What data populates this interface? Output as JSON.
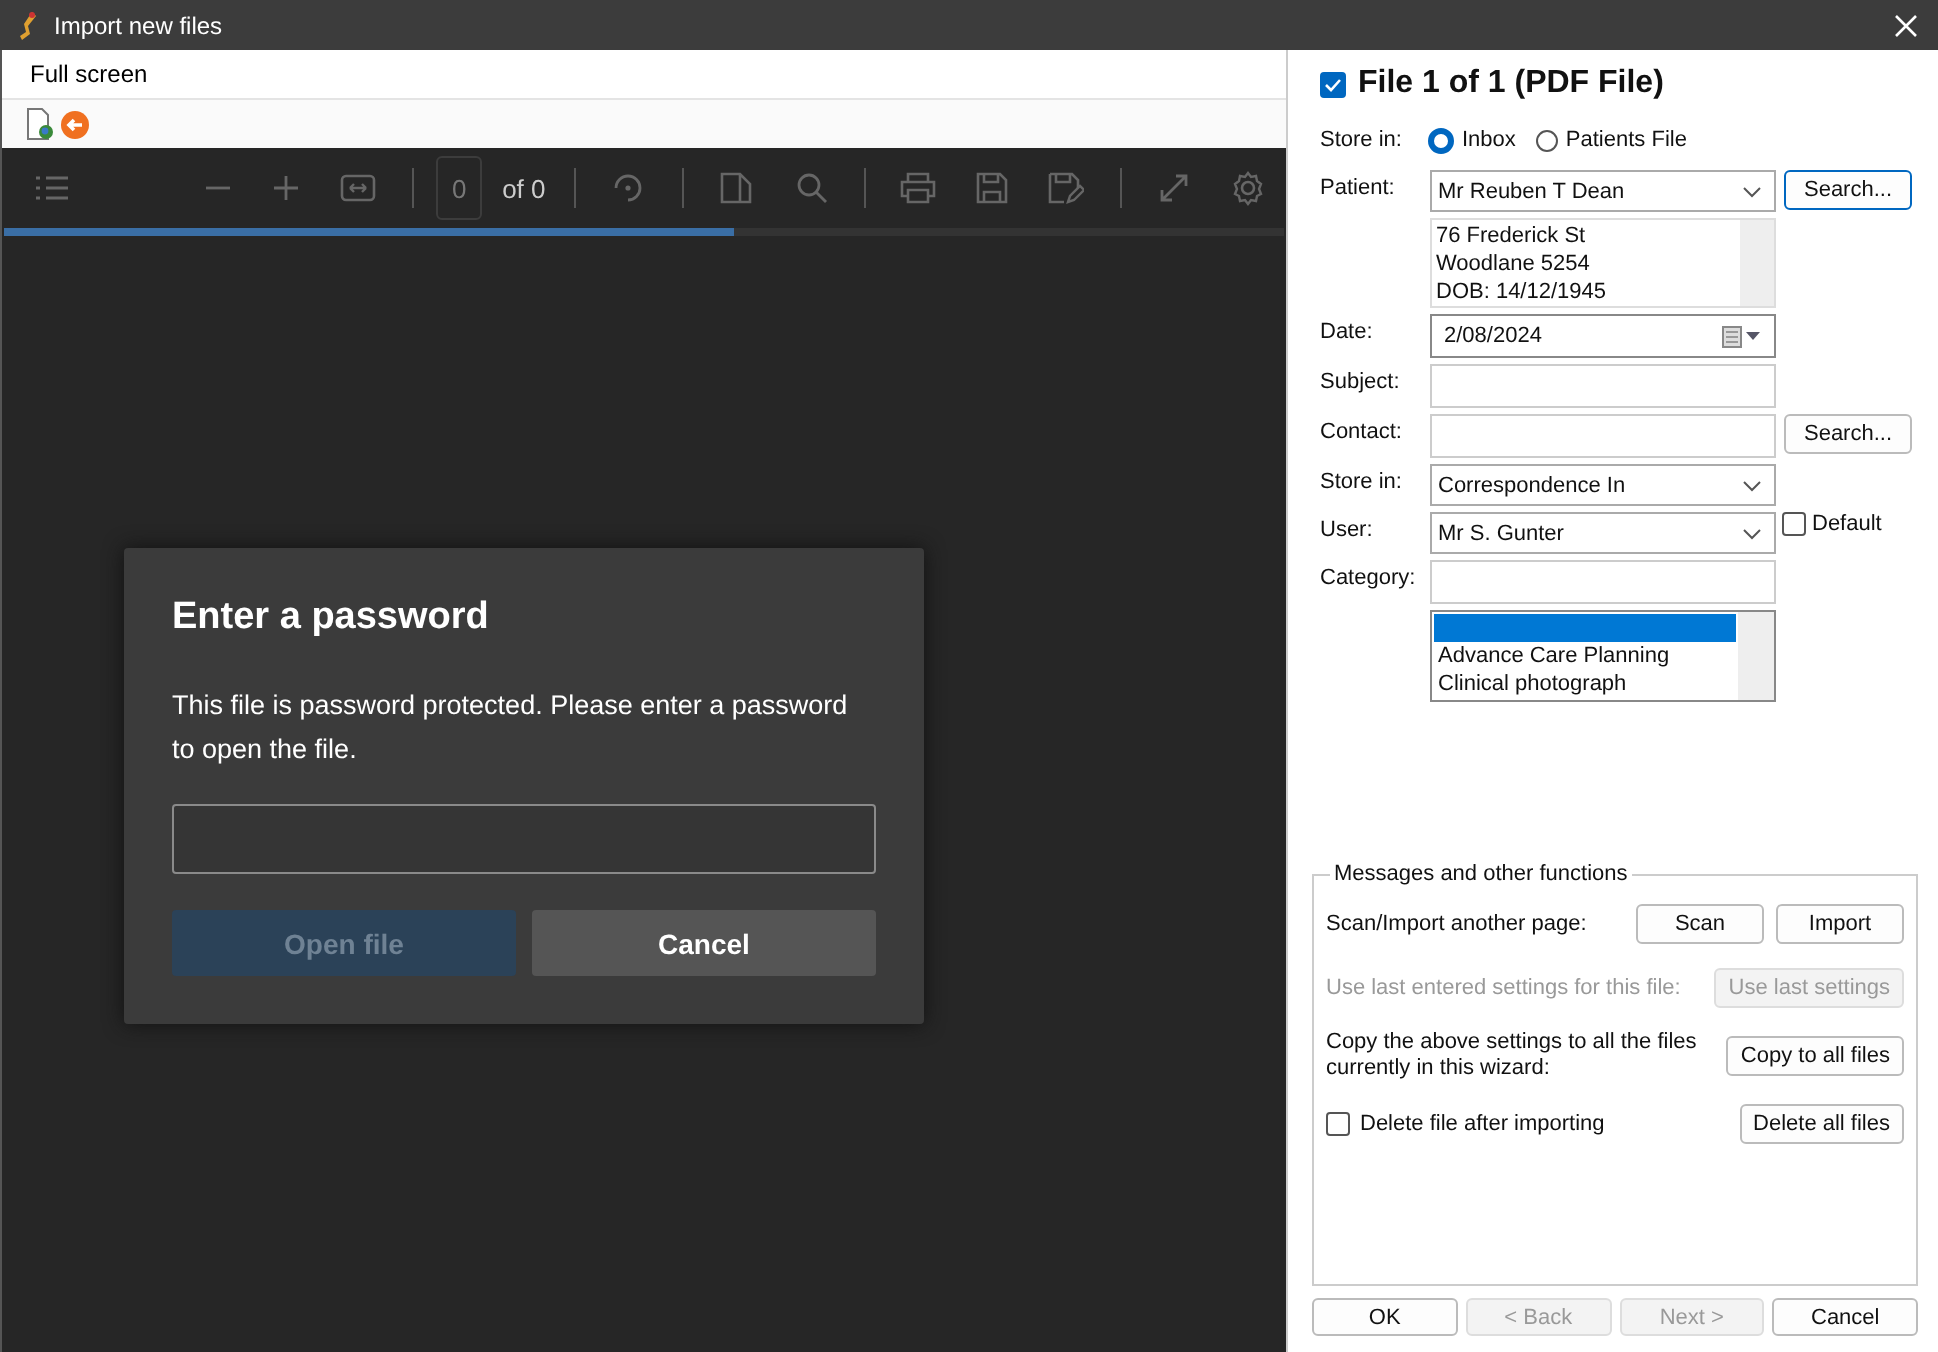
{
  "window": {
    "title": "Import new files"
  },
  "menu": {
    "items": [
      "Full screen"
    ]
  },
  "pdf_toolbar": {
    "page_input": "0",
    "page_count": "of 0"
  },
  "load_progress": {
    "level": 0.57
  },
  "password_dialog": {
    "title": "Enter a password",
    "message": "This file is password protected. Please enter a password to open the file.",
    "buttons": [
      {
        "label": "Open file",
        "kind": "primary",
        "disabled": true
      },
      {
        "label": "Cancel",
        "kind": "secondary",
        "disabled": false
      }
    ]
  },
  "file_panel": {
    "header": {
      "label": "File 1 of 1 (PDF File)",
      "checked": true
    },
    "store_location": {
      "label": "Store in:",
      "options": [
        {
          "label": "Inbox",
          "selected": true
        },
        {
          "label": "Patients File",
          "selected": false
        }
      ]
    },
    "patient": {
      "label": "Patient:",
      "value": "Mr Reuben T Dean",
      "button": "Search...",
      "details": [
        "76 Frederick St",
        "Woodlane  5254",
        "DOB: 14/12/1945"
      ]
    },
    "date": {
      "label": "Date:",
      "value": "2/08/2024"
    },
    "subject": {
      "label": "Subject:"
    },
    "contact": {
      "label": "Contact:",
      "button": "Search..."
    },
    "store_folder": {
      "label": "Store in:",
      "value": "Correspondence In"
    },
    "user": {
      "label": "User:",
      "value": "Mr S. Gunter",
      "default": {
        "label": "Default",
        "checked": false
      }
    },
    "category": {
      "label": "Category:",
      "blank_item": {
        "selected": true
      },
      "items": [
        {
          "label": "Advance Care Planning",
          "selected": false
        },
        {
          "label": "Clinical photograph",
          "selected": false
        }
      ]
    }
  },
  "functions": {
    "title": "Messages and other functions",
    "rows": [
      {
        "kind": "text",
        "label": "Scan/Import another page:",
        "buttons": [
          {
            "label": "Scan",
            "disabled": false
          },
          {
            "label": "Import",
            "disabled": false
          }
        ]
      },
      {
        "kind": "text",
        "label": "Use last entered settings for this file:",
        "buttons": [
          {
            "label": "Use last settings",
            "disabled": true
          }
        ]
      },
      {
        "kind": "text",
        "label": "Copy the above settings to all the files currently in this wizard:",
        "buttons": [
          {
            "label": "Copy to all files",
            "disabled": false
          }
        ]
      },
      {
        "kind": "checkbox",
        "label": "Delete file after importing",
        "checked": false,
        "buttons": [
          {
            "label": "Delete all files",
            "disabled": false
          }
        ]
      }
    ]
  },
  "footer_buttons": [
    {
      "label": "OK",
      "disabled": false
    },
    {
      "label": "< Back",
      "disabled": true
    },
    {
      "label": "Next >",
      "disabled": true
    },
    {
      "label": "Cancel",
      "disabled": false
    }
  ]
}
